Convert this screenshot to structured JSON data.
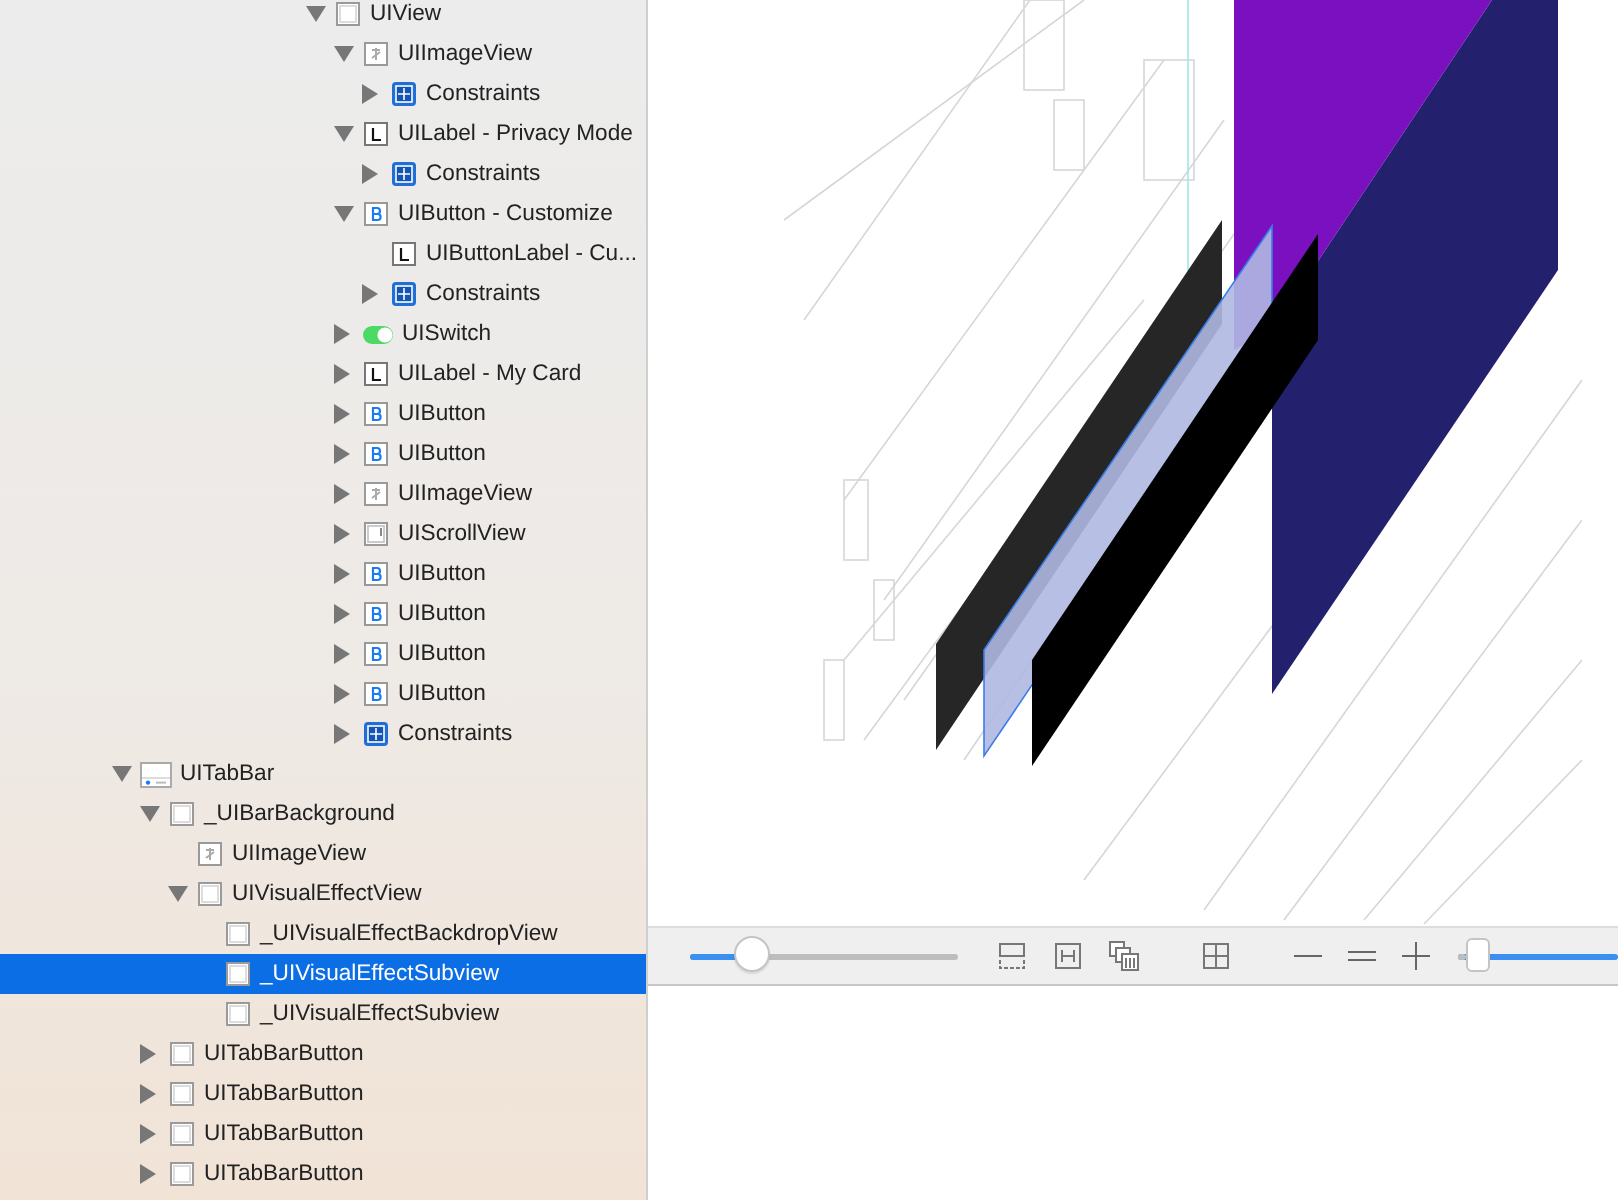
{
  "tree": [
    {
      "label": "UIView",
      "kind": "view",
      "expanded": true,
      "selected": false,
      "children": [
        {
          "label": "UIImageView",
          "kind": "image",
          "expanded": true,
          "selected": false,
          "children": [
            {
              "label": "Constraints",
              "kind": "constraints",
              "expanded": false,
              "selected": false
            }
          ]
        },
        {
          "label": "UILabel - Privacy Mode",
          "kind": "label",
          "expanded": true,
          "selected": false,
          "children": [
            {
              "label": "Constraints",
              "kind": "constraints",
              "expanded": false,
              "selected": false
            }
          ]
        },
        {
          "label": "UIButton - Customize",
          "kind": "button",
          "expanded": true,
          "selected": false,
          "children": [
            {
              "label": "UIButtonLabel - Cu...",
              "kind": "label",
              "selected": false
            },
            {
              "label": "Constraints",
              "kind": "constraints",
              "expanded": false,
              "selected": false
            }
          ]
        },
        {
          "label": "UISwitch",
          "kind": "switch",
          "expanded": false,
          "selected": false
        },
        {
          "label": "UILabel - My Card",
          "kind": "label",
          "expanded": false,
          "selected": false
        },
        {
          "label": "UIButton",
          "kind": "button",
          "expanded": false,
          "selected": false
        },
        {
          "label": "UIButton",
          "kind": "button",
          "expanded": false,
          "selected": false
        },
        {
          "label": "UIImageView",
          "kind": "image",
          "expanded": false,
          "selected": false
        },
        {
          "label": "UIScrollView",
          "kind": "scroll",
          "expanded": false,
          "selected": false
        },
        {
          "label": "UIButton",
          "kind": "button",
          "expanded": false,
          "selected": false
        },
        {
          "label": "UIButton",
          "kind": "button",
          "expanded": false,
          "selected": false
        },
        {
          "label": "UIButton",
          "kind": "button",
          "expanded": false,
          "selected": false
        },
        {
          "label": "UIButton",
          "kind": "button",
          "expanded": false,
          "selected": false
        },
        {
          "label": "Constraints",
          "kind": "constraints",
          "expanded": false,
          "selected": false
        }
      ]
    },
    {
      "label": "UITabBar",
      "kind": "tabbar",
      "expanded": true,
      "selected": false,
      "children": [
        {
          "label": "_UIBarBackground",
          "kind": "view",
          "expanded": true,
          "selected": false,
          "children": [
            {
              "label": "UIImageView",
              "kind": "image",
              "selected": false
            },
            {
              "label": "UIVisualEffectView",
              "kind": "view",
              "expanded": true,
              "selected": false,
              "children": [
                {
                  "label": "_UIVisualEffectBackdropView",
                  "kind": "view",
                  "selected": false
                },
                {
                  "label": "_UIVisualEffectSubview",
                  "kind": "view",
                  "selected": true
                },
                {
                  "label": "_UIVisualEffectSubview",
                  "kind": "view",
                  "selected": false
                }
              ]
            }
          ]
        },
        {
          "label": "UITabBarButton",
          "kind": "view",
          "expanded": false,
          "selected": false
        },
        {
          "label": "UITabBarButton",
          "kind": "view",
          "expanded": false,
          "selected": false
        },
        {
          "label": "UITabBarButton",
          "kind": "view",
          "expanded": false,
          "selected": false
        },
        {
          "label": "UITabBarButton",
          "kind": "view",
          "expanded": false,
          "selected": false
        }
      ]
    }
  ],
  "toolbar": {
    "spacing_slider": {
      "level": 0.23
    },
    "zoom_slider": {
      "level": 0.05
    }
  }
}
